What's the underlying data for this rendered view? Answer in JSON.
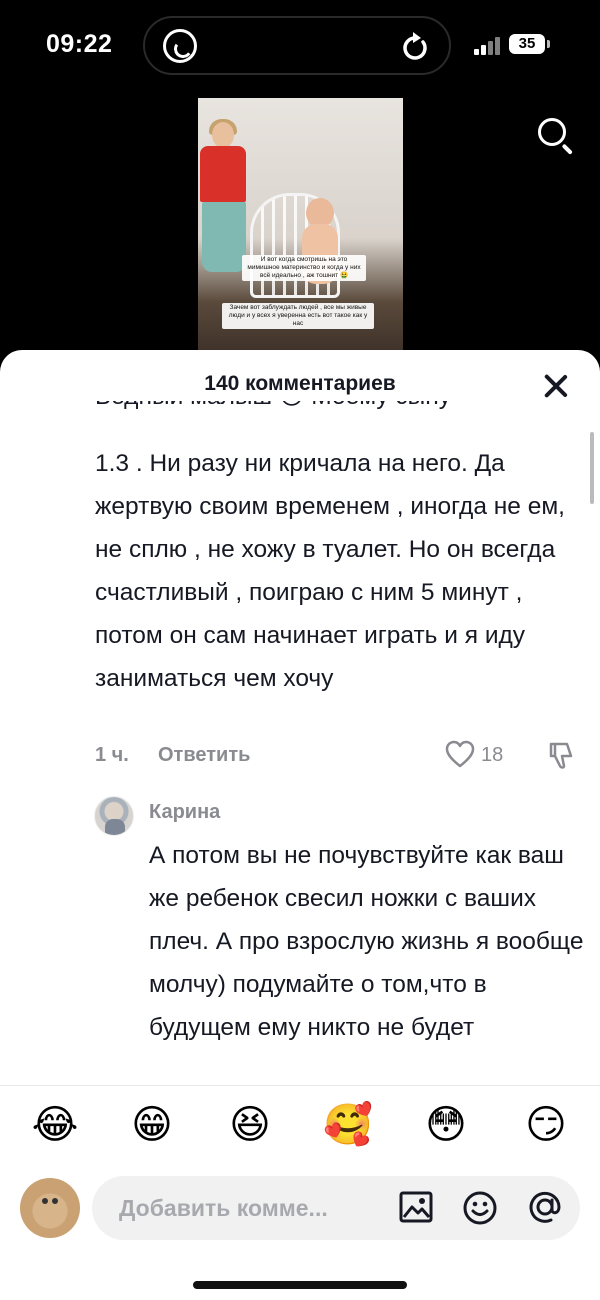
{
  "status_bar": {
    "time": "09:22",
    "battery": "35",
    "app_indicator": "whatsapp-icon"
  },
  "video": {
    "caption_1": "И вот когда смотришь на это мимишное материнство и когда у них всё идеально , аж тошнит 🤮",
    "caption_2": "Зачем вот заблуждать людей , все мы живые люди и у всех я уверенна есть вот такое как у нас"
  },
  "comments_sheet": {
    "title": "140 комментариев",
    "comment": {
      "cut_line": "Бедный малыш 😔 Моему сыну",
      "text": "1.3 . Ни разу ни кричала на него. Да жертвую своим временем , иногда не ем, не сплю , не хожу в туалет. Но он всегда счастливый , поиграю с ним 5 минут , потом он сам начинает играть и я иду заниматься чем хочу",
      "time": "1 ч.",
      "reply_label": "Ответить",
      "likes": "18"
    },
    "reply": {
      "author": "Карина",
      "text": "А потом вы не почувствуйте как ваш же ребенок свесил ножки с ваших плеч. А про взрослую жизнь я вообще молчу) подумайте о том,что в будущем ему никто не будет"
    }
  },
  "bottom_bar": {
    "emojis": [
      "😂",
      "😁",
      "😆",
      "🥰",
      "😳",
      "😏"
    ],
    "input_placeholder": "Добавить комме..."
  },
  "colors": {
    "text_primary": "#161823",
    "text_secondary": "#8a8b91",
    "input_bg": "#f1f1f2"
  }
}
